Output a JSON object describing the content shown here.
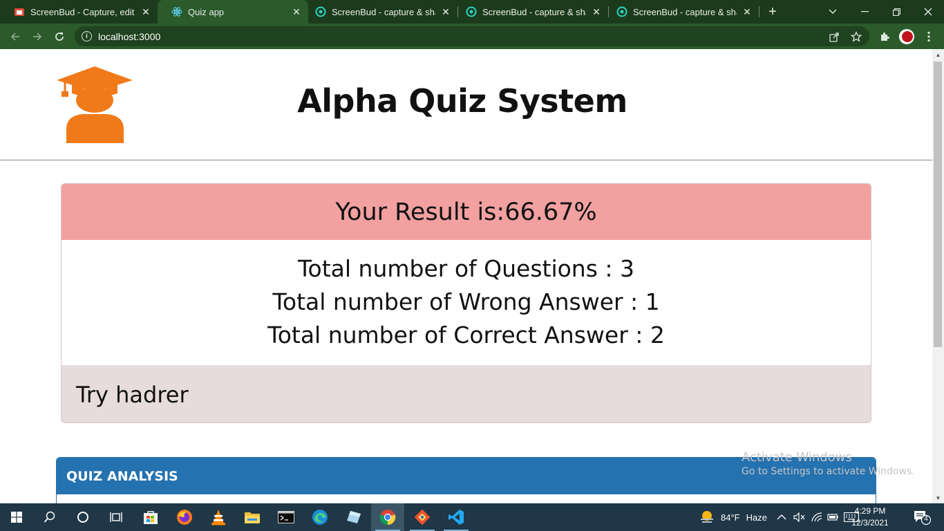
{
  "browser": {
    "tabs": [
      {
        "title": "ScreenBud - Capture, edit & s",
        "icon": "screenbud-red-icon",
        "active": false
      },
      {
        "title": "Quiz app",
        "icon": "react-icon",
        "active": true
      },
      {
        "title": "ScreenBud - capture & share",
        "icon": "screenbud-teal-icon",
        "active": false
      },
      {
        "title": "ScreenBud - capture & share",
        "icon": "screenbud-teal-icon",
        "active": false
      },
      {
        "title": "ScreenBud - capture & share",
        "icon": "screenbud-teal-icon",
        "active": false
      }
    ],
    "url": "localhost:3000",
    "colors": {
      "frame": "#1c3a1c",
      "toolbar": "#2b5a2b"
    }
  },
  "page": {
    "app_title": "Alpha Quiz System",
    "result": {
      "heading": "Your Result is:66.67%",
      "total_questions": "Total number of Questions : 3",
      "wrong_answers": "Total number of Wrong Answer : 1",
      "correct_answers": "Total number of Correct Answer : 2",
      "footer_message": "Try hadrer"
    },
    "analysis_title": "QUIZ ANALYSIS",
    "colors": {
      "result_header": "#f2a0a0",
      "result_footer": "#e6dcdb",
      "analysis_header": "#2572b0",
      "logo": "#f07a1a"
    }
  },
  "watermark": {
    "line1": "Activate Windows",
    "line2": "Go to Settings to activate Windows."
  },
  "taskbar": {
    "apps": [
      "windows-start-icon",
      "search-icon",
      "cortana-icon",
      "task-view-icon",
      "microsoft-store-icon",
      "firefox-icon",
      "vlc-icon",
      "file-explorer-icon",
      "terminal-icon",
      "edge-icon",
      "notepad-icon",
      "chrome-icon",
      "git-icon",
      "vscode-icon"
    ],
    "weather_temp": "84°F",
    "weather_desc": "Haze",
    "time": "4:29 PM",
    "date": "12/3/2021",
    "notification_count": "4"
  }
}
